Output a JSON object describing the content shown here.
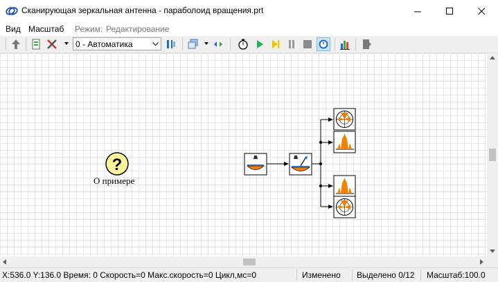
{
  "window": {
    "title": "Сканирующая зеркальная антенна - параболоид вращения.prt",
    "controls": [
      "minimize-icon",
      "maximize-icon",
      "close-icon"
    ]
  },
  "menu": {
    "view": "Вид",
    "scale": "Масштаб",
    "mode_label": "Режим:",
    "mode_value": "Редактирование"
  },
  "toolbar": {
    "mode_select": {
      "value": "0 - Автоматика"
    },
    "icons": [
      "up-arrow-icon",
      "script-icon",
      "tools-icon",
      "columns-icon",
      "windows-icon",
      "link-icon",
      "stopwatch-icon",
      "play-icon",
      "step-icon",
      "pause-icon",
      "stop-icon",
      "clock-icon",
      "bar-chart-icon",
      "export-icon"
    ]
  },
  "canvas": {
    "help_label": "О примере",
    "blocks": [
      "source-block-icon",
      "antenna-block-icon",
      "radar-display-icon",
      "pattern-display-icon",
      "pattern-display-icon",
      "radar-display-icon"
    ]
  },
  "status": {
    "coords": "X:536.0  Y:136.0 Время: 0 Скорость=0 Макс.скорость=0 Цикл,мс=0",
    "changed": "Изменено",
    "selected": "Выделено 0/12",
    "scale": "Масштаб:100.0"
  },
  "colors": {
    "accent_orange": "#f08000",
    "play_green": "#22b14c",
    "step_yellow": "#e8c800",
    "help_yellow": "#fff59d"
  }
}
